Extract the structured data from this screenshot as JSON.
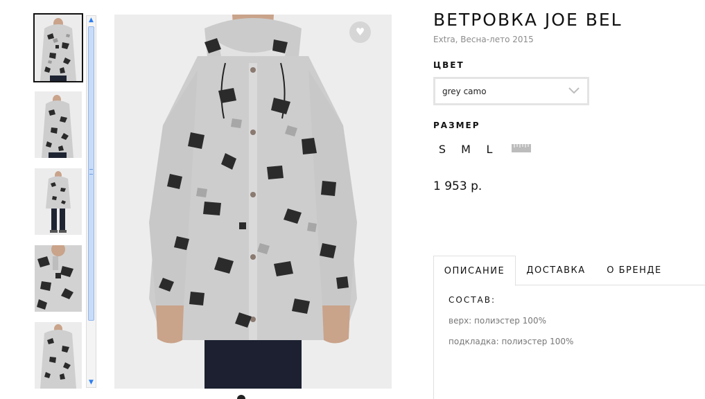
{
  "product": {
    "title": "ВЕТРОВКА JOE BEL",
    "subtitle": "Extra, Весна-лето 2015",
    "price": "1 953 р."
  },
  "color": {
    "label": "ЦВЕТ",
    "selected": "grey camo"
  },
  "size": {
    "label": "РАЗМЕР",
    "options": [
      "S",
      "M",
      "L"
    ]
  },
  "gallery": {
    "thumbnail_count": 5,
    "active_index": 0
  },
  "tabs": [
    {
      "label": "ОПИСАНИЕ",
      "active": true
    },
    {
      "label": "ДОСТАВКА",
      "active": false
    },
    {
      "label": "О БРЕНДЕ",
      "active": false
    }
  ],
  "description": {
    "heading": "СОСТАВ:",
    "lines": [
      "верх: полиэстер 100%",
      "подкладка: полиэстер 100%"
    ]
  },
  "icons": {
    "favorite": "heart-icon",
    "select": "chevron-down-icon",
    "size_guide": "ruler-icon"
  }
}
